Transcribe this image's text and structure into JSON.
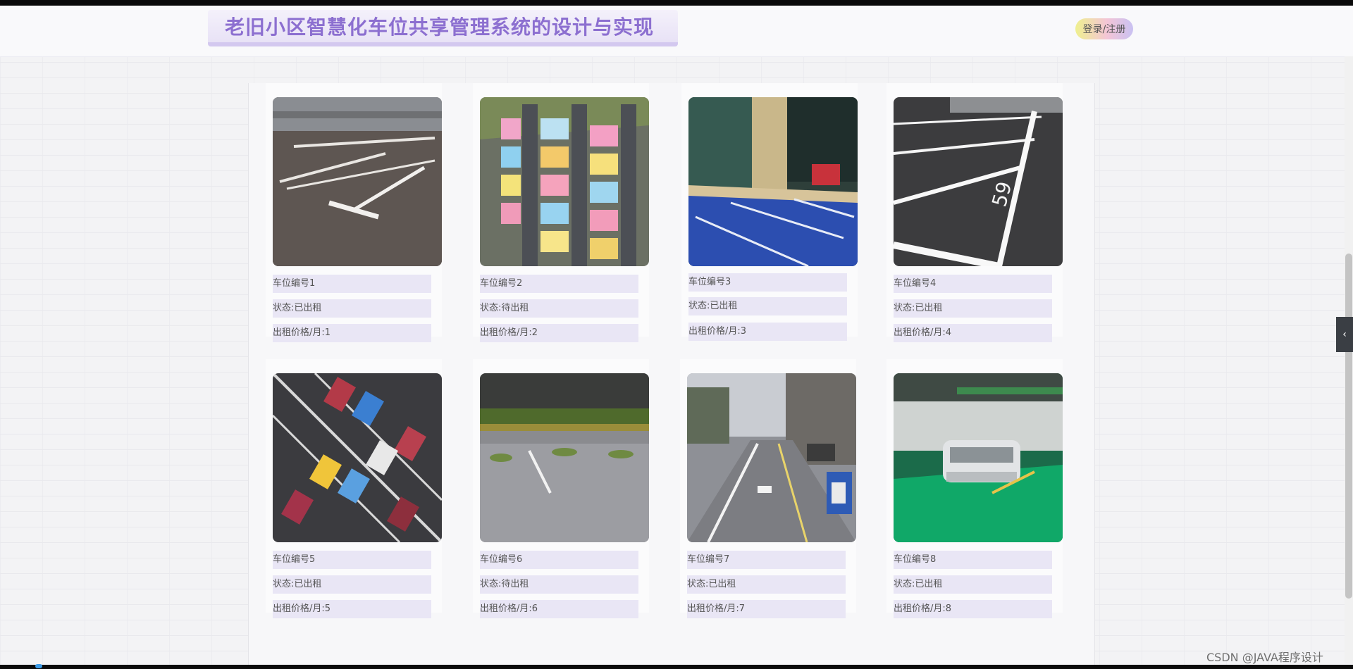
{
  "header": {
    "title": "老旧小区智慧化车位共享管理系统的设计与实现",
    "login_label": "登录/注册"
  },
  "sidebar_tab": {
    "icon": "chevron-left-icon",
    "glyph": "‹"
  },
  "watermark": "CSDN @JAVA程序设计",
  "parking_spaces": [
    {
      "number": "车位编号1",
      "status": "状态:已出租",
      "price": "出租价格/月:1",
      "image": "parking-lot-photo-1"
    },
    {
      "number": "车位编号2",
      "status": "状态:待出租",
      "price": "出租价格/月:2",
      "image": "parking-lot-photo-2"
    },
    {
      "number": "车位编号3",
      "status": "状态:已出租",
      "price": "出租价格/月:3",
      "image": "parking-lot-photo-3"
    },
    {
      "number": "车位编号4",
      "status": "状态:已出租",
      "price": "出租价格/月:4",
      "image": "parking-lot-photo-4"
    },
    {
      "number": "车位编号5",
      "status": "状态:已出租",
      "price": "出租价格/月:5",
      "image": "parking-lot-photo-5"
    },
    {
      "number": "车位编号6",
      "status": "状态:待出租",
      "price": "出租价格/月:6",
      "image": "parking-lot-photo-6"
    },
    {
      "number": "车位编号7",
      "status": "状态:已出租",
      "price": "出租价格/月:7",
      "image": "parking-lot-photo-7"
    },
    {
      "number": "车位编号8",
      "status": "状态:已出租",
      "price": "出租价格/月:8",
      "image": "parking-lot-photo-8"
    }
  ]
}
